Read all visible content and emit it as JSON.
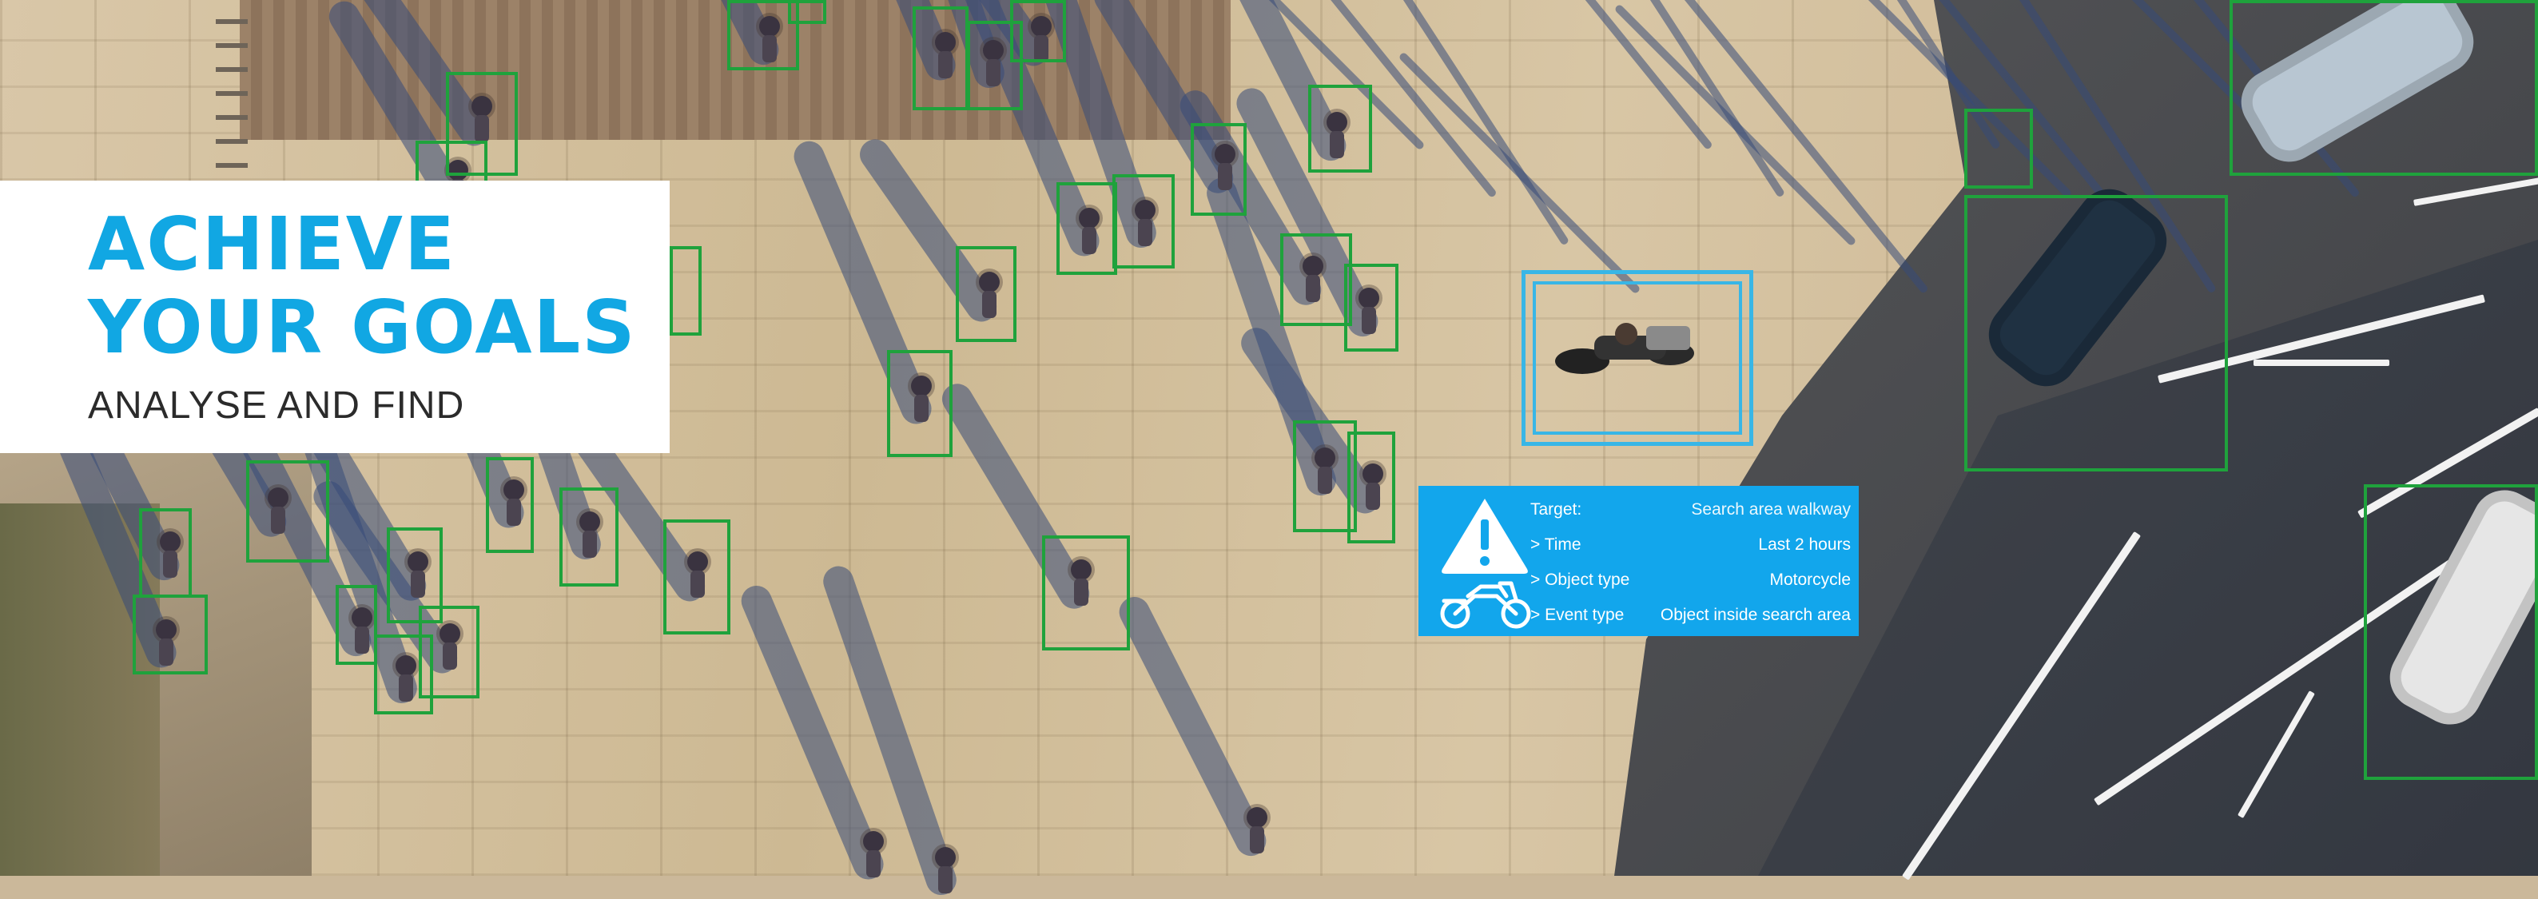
{
  "headline": {
    "line1": "ACHIEVE",
    "line2": "YOUR GOALS",
    "subtitle": "ANALYSE AND FIND"
  },
  "alert": {
    "icon": "warning-icon",
    "object_icon": "motorcycle-icon",
    "rows": [
      {
        "key": "Target:",
        "value": "Search area walkway"
      },
      {
        "key": "> Time",
        "value": "Last 2 hours"
      },
      {
        "key": "> Object type",
        "value": "Motorcycle"
      },
      {
        "key": "> Event type",
        "value": "Object inside search area"
      }
    ]
  },
  "colors": {
    "headline": "#11a7e3",
    "panel": "#12a6ec",
    "detection_box": "#1fa23c",
    "target_box": "#38b6e6"
  }
}
